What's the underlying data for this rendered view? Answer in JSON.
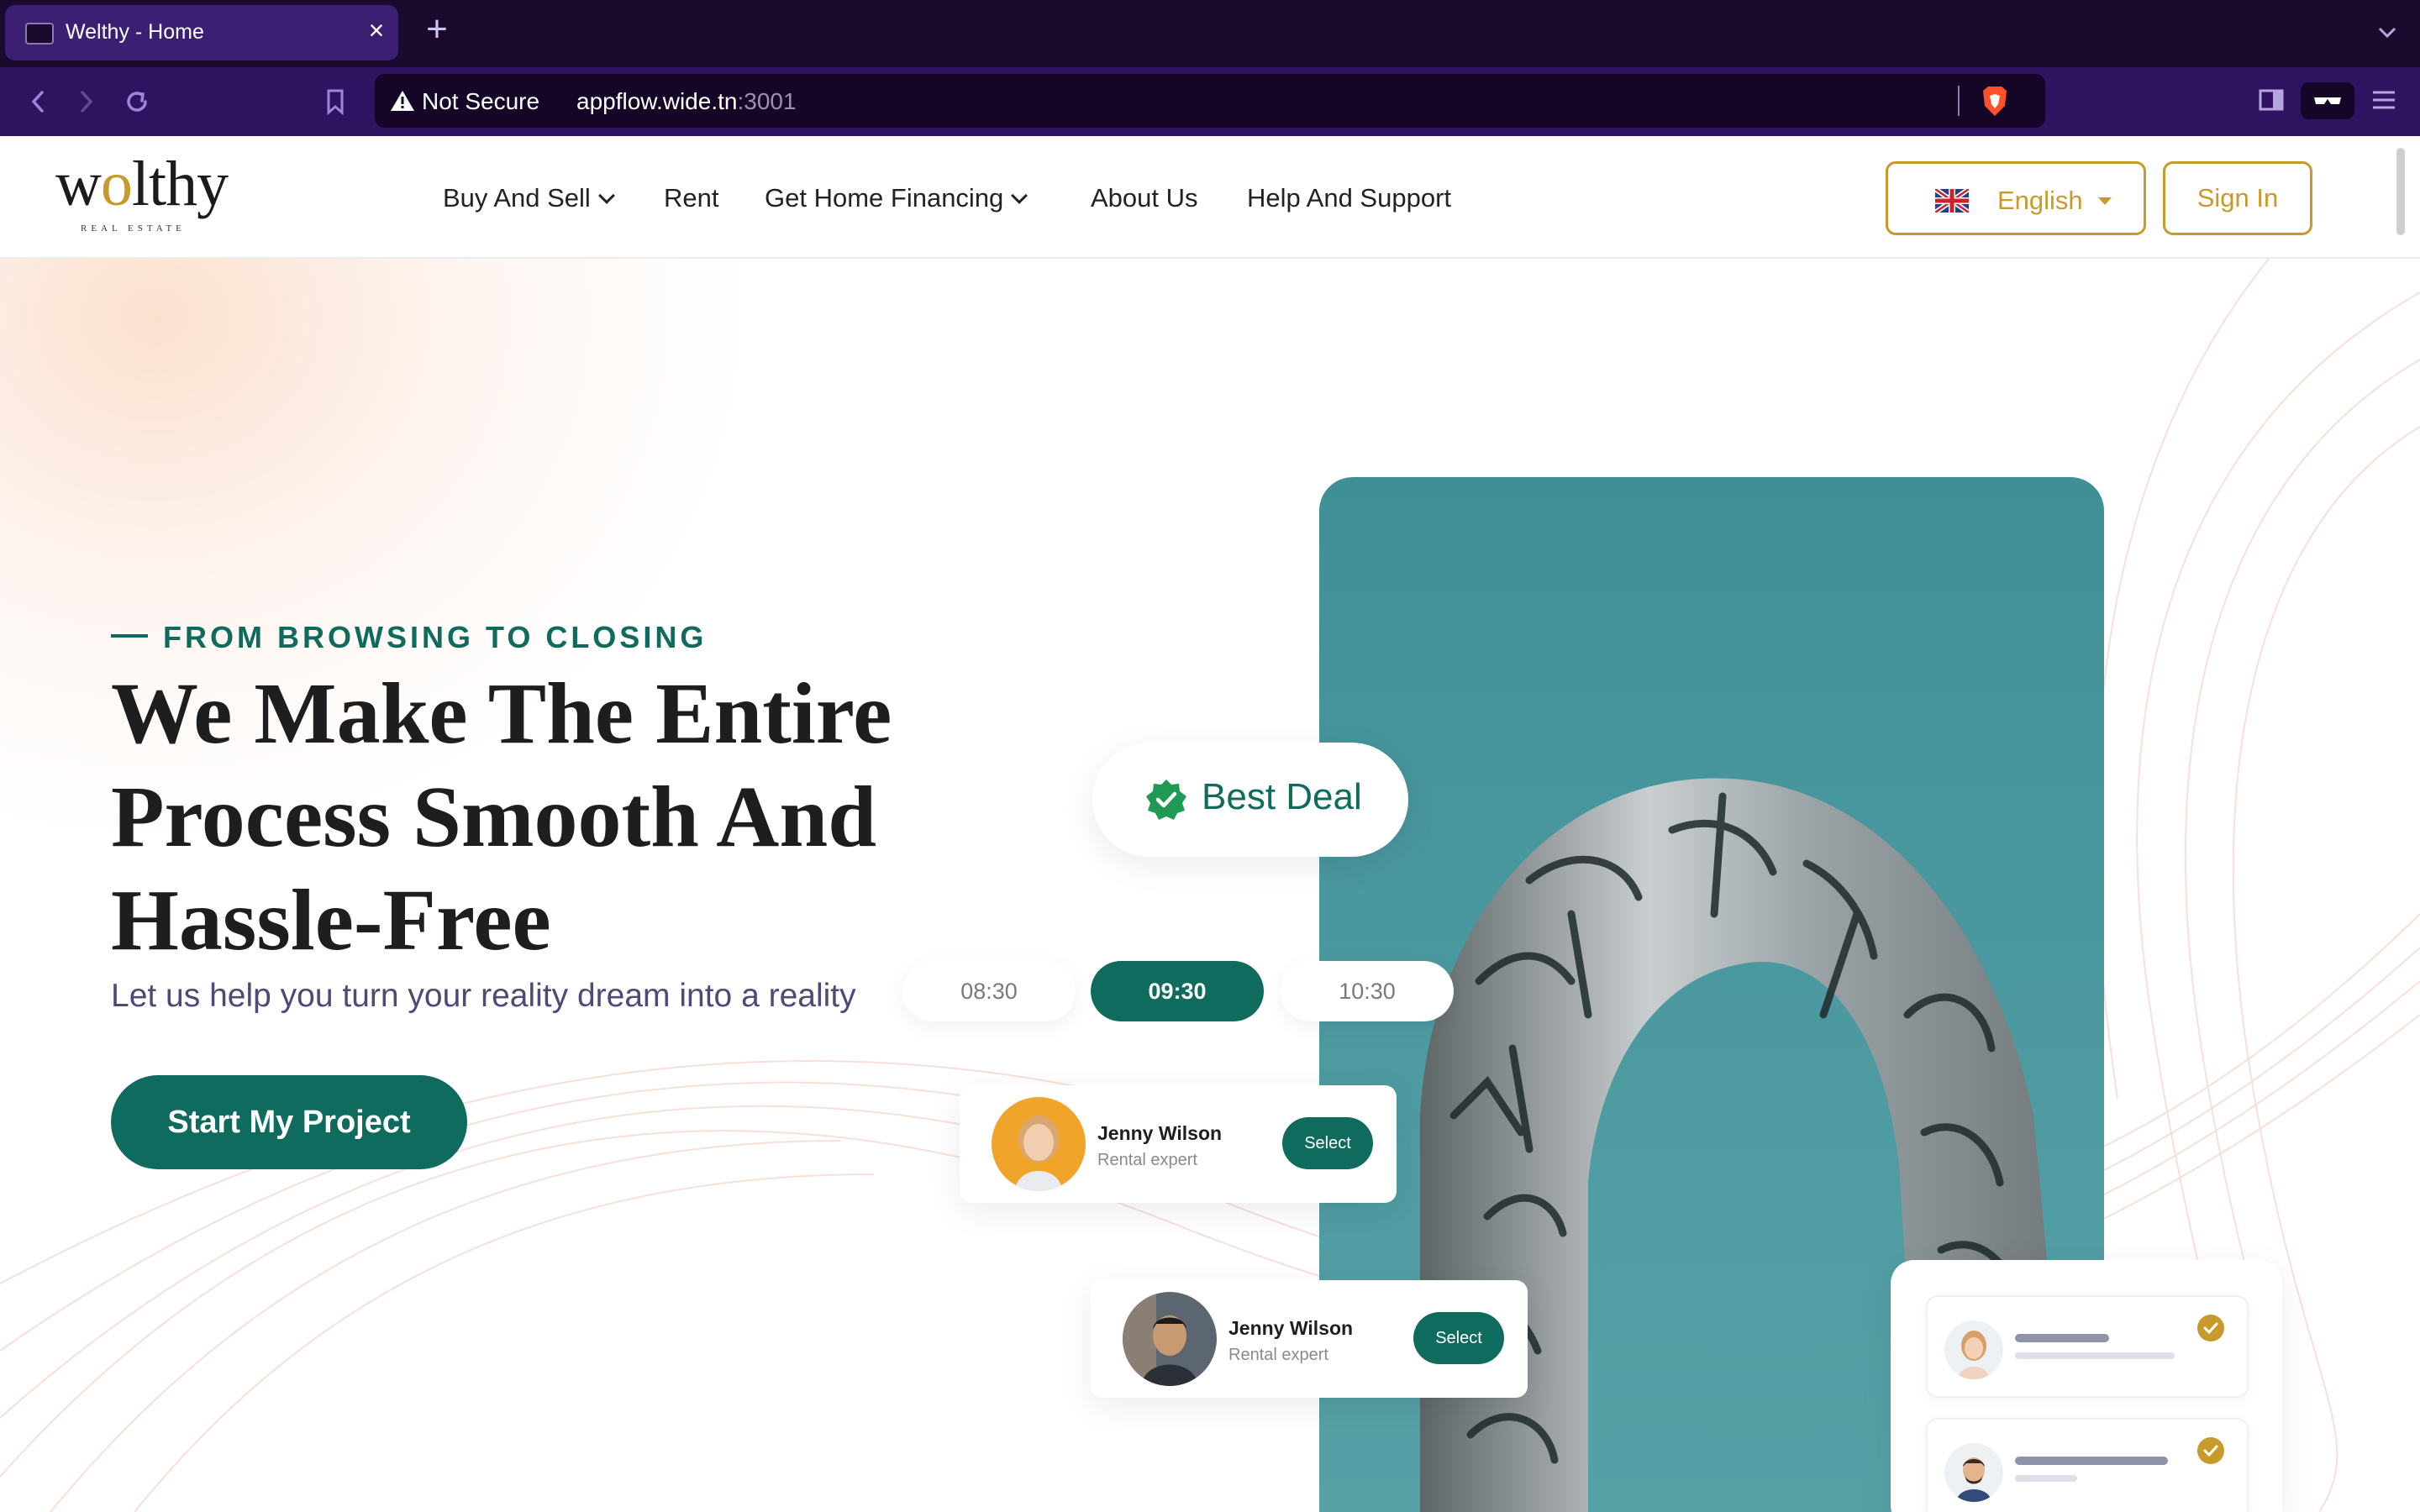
{
  "browser": {
    "tab_title": "Welthy - Home",
    "new_tab": "+",
    "close_tab": "×",
    "security_label": "Not Secure",
    "url_host": "appflow.wide.tn",
    "url_port": ":3001"
  },
  "header": {
    "logo_text_pre": "w",
    "logo_text_o": "o",
    "logo_text_post": "lthy",
    "logo_sub": "REAL ESTATE",
    "nav": [
      {
        "label": "Buy And Sell",
        "dropdown": true
      },
      {
        "label": "Rent",
        "dropdown": false
      },
      {
        "label": "Get Home Financing",
        "dropdown": true
      },
      {
        "label": "About Us",
        "dropdown": false
      },
      {
        "label": "Help And Support",
        "dropdown": false
      }
    ],
    "language": "English",
    "sign_in": "Sign In"
  },
  "hero": {
    "eyebrow": "FROM BROWSING TO CLOSING",
    "headline": "We Make The Entire Process Smooth And Hassle-Free",
    "subline": "Let us help you turn your reality dream into a reality",
    "cta": "Start My Project",
    "best_deal": "Best Deal",
    "times": [
      {
        "label": "08:30",
        "selected": false
      },
      {
        "label": "09:30",
        "selected": true
      },
      {
        "label": "10:30",
        "selected": false
      }
    ],
    "agents": [
      {
        "name": "Jenny Wilson",
        "role": "Rental expert",
        "action": "Select"
      },
      {
        "name": "Jenny Wilson",
        "role": "Rental expert",
        "action": "Select"
      }
    ]
  },
  "colors": {
    "brand_green": "#0e6b5e",
    "brand_gold": "#c79a2b",
    "browser_bg": "#1a0a2e"
  }
}
